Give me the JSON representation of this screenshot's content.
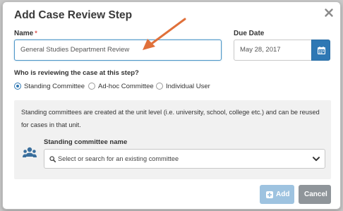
{
  "dialog": {
    "title": "Add Case Review Step"
  },
  "name_field": {
    "label": "Name",
    "required_marker": "*",
    "value": "General Studies Department Review"
  },
  "due_date": {
    "label": "Due Date",
    "value": "May 28, 2017"
  },
  "reviewer": {
    "question": "Who is reviewing the case at this step?",
    "options": [
      {
        "label": "Standing Committee",
        "selected": true
      },
      {
        "label": "Ad-hoc Committee",
        "selected": false
      },
      {
        "label": "Individual User",
        "selected": false
      }
    ]
  },
  "panel": {
    "info_text": "Standing committees are created at the unit level (i.e. university, school, college etc.) and can be reused for cases in that unit.",
    "committee_label": "Standing committee name",
    "select_placeholder": "Select or search for an existing committee"
  },
  "buttons": {
    "add_label": "Add",
    "cancel_label": "Cancel"
  },
  "colors": {
    "accent": "#2f78b4",
    "annotation_arrow": "#e0703a",
    "add_disabled": "#9ec3e0",
    "cancel": "#8f959a"
  }
}
